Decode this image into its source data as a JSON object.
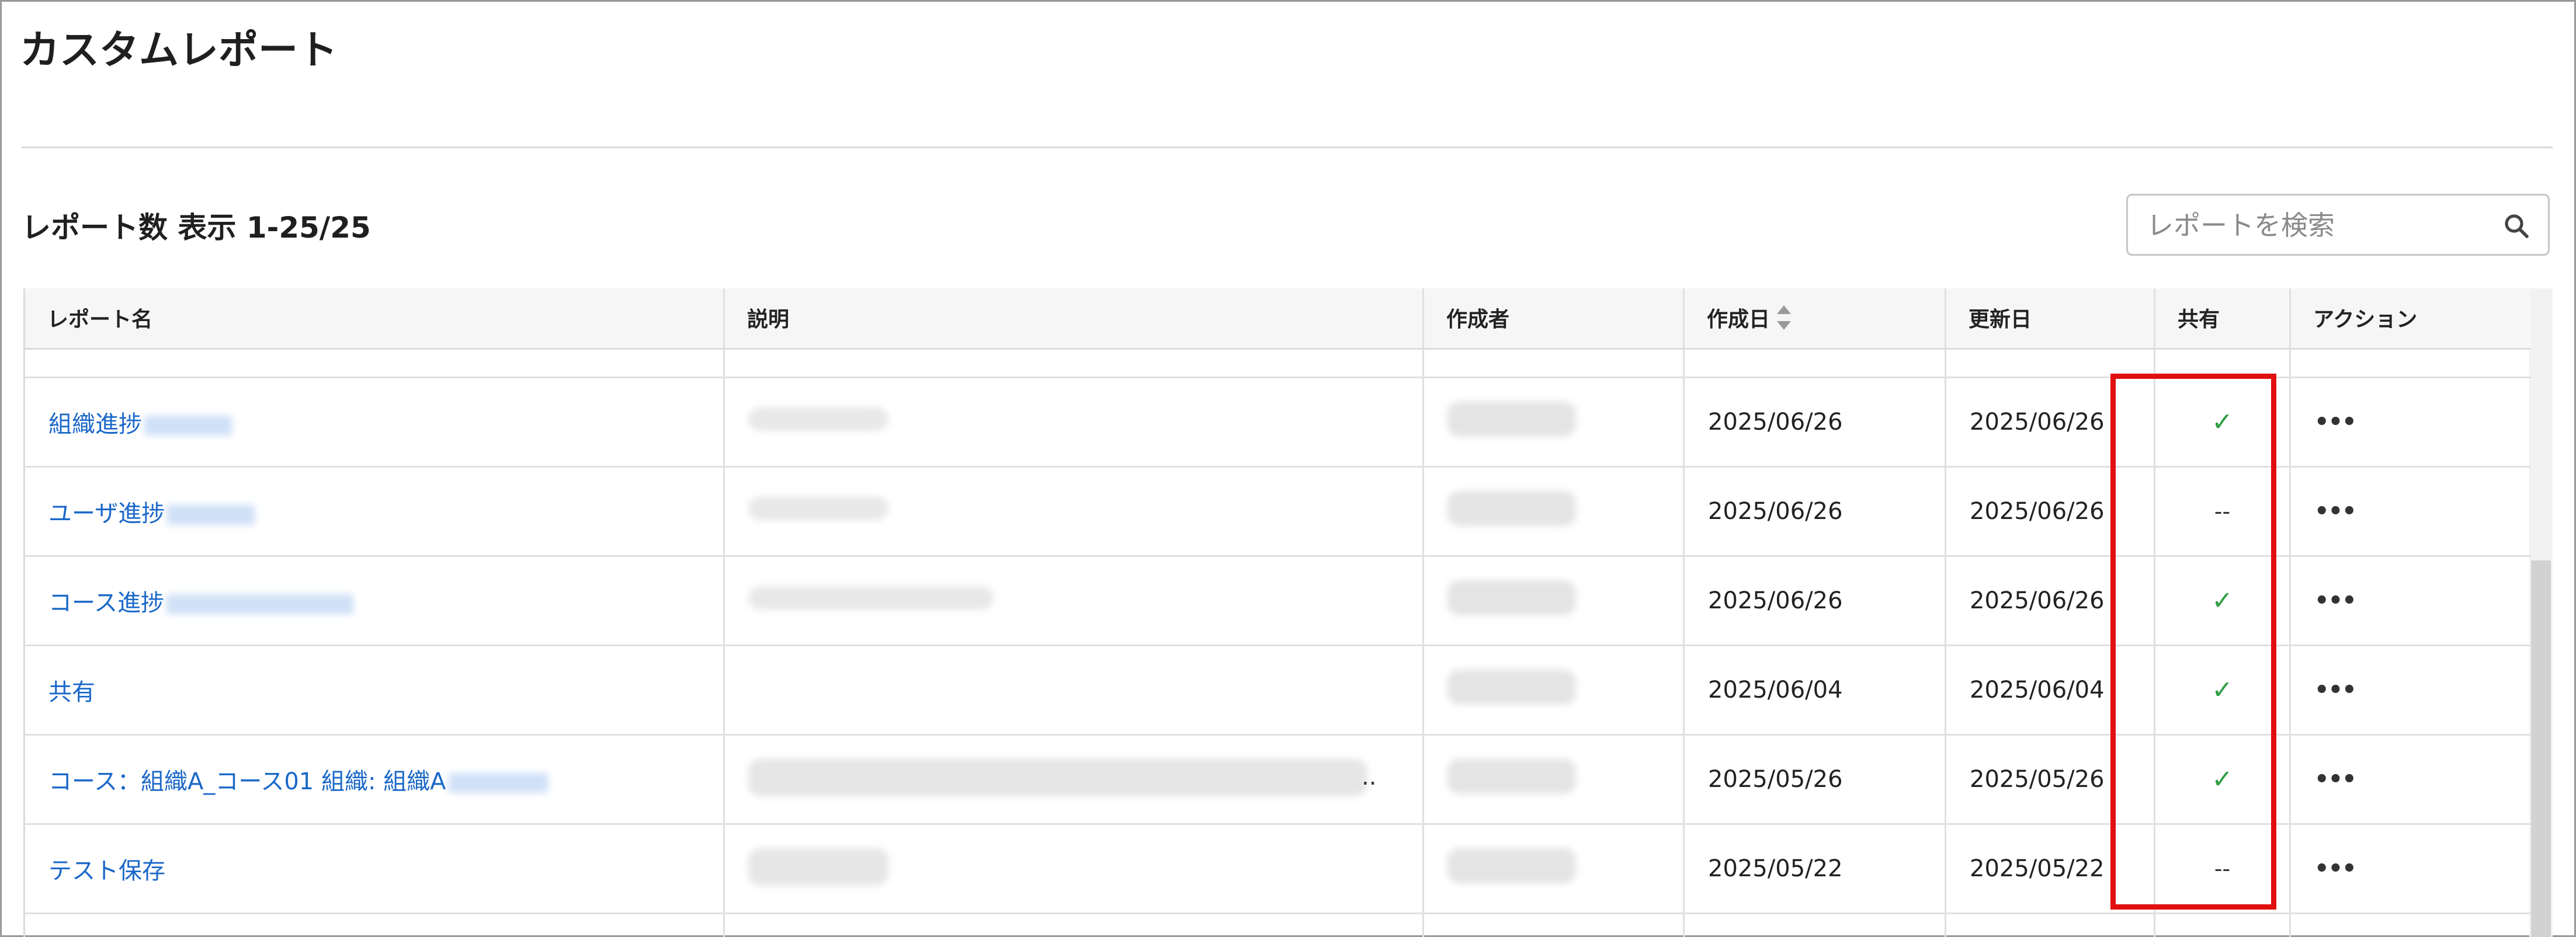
{
  "page": {
    "title": "カスタムレポート"
  },
  "summary": {
    "count_text": "レポート数 表示 1-25/25"
  },
  "search": {
    "placeholder": "レポートを検索"
  },
  "table": {
    "columns": [
      "レポート名",
      "説明",
      "作成者",
      "作成日",
      "更新日",
      "共有",
      "アクション"
    ],
    "rows": [
      {
        "name": "組織進捗",
        "created": "2025/06/26",
        "updated": "2025/06/26",
        "shared": "✓",
        "actions": "•••"
      },
      {
        "name": "ユーザ進捗",
        "created": "2025/06/26",
        "updated": "2025/06/26",
        "shared": "--",
        "actions": "•••"
      },
      {
        "name": "コース進捗",
        "created": "2025/06/26",
        "updated": "2025/06/26",
        "shared": "✓",
        "actions": "•••"
      },
      {
        "name": "共有",
        "created": "2025/06/04",
        "updated": "2025/06/04",
        "shared": "✓",
        "actions": "•••"
      },
      {
        "name": "コース：組織A_コース01 組織: 組織A",
        "created": "2025/05/26",
        "updated": "2025/05/26",
        "shared": "✓",
        "actions": "•••",
        "description_ellipsis": ".."
      },
      {
        "name": "テスト保存",
        "created": "2025/05/22",
        "updated": "2025/05/22",
        "shared": "--",
        "actions": "•••"
      }
    ]
  },
  "icons": {
    "search": "search-icon",
    "sort": "sort-icon",
    "check": "check-icon",
    "more": "more-icon"
  },
  "colors": {
    "link": "#1b68c8",
    "check": "#2f9e44",
    "highlight": "#e01010"
  }
}
